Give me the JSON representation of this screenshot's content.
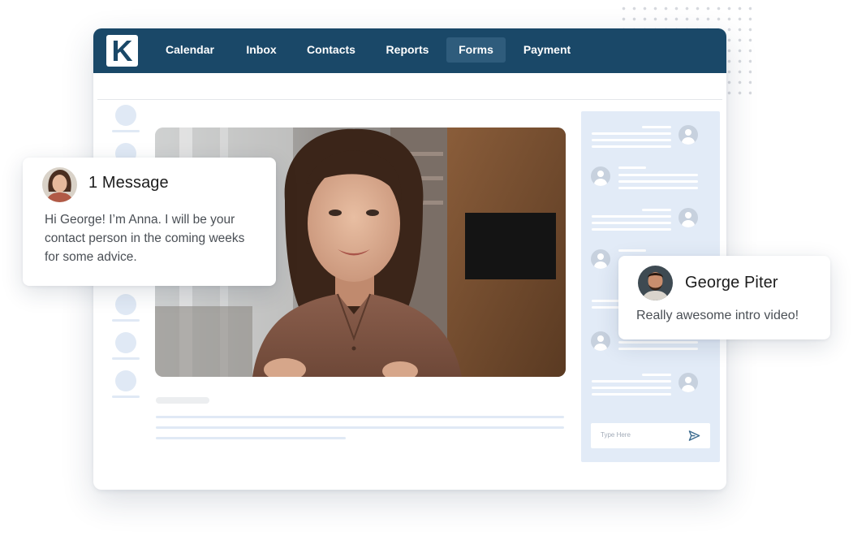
{
  "app": {
    "logo_letter": "K"
  },
  "nav": {
    "items": [
      {
        "label": "Calendar"
      },
      {
        "label": "Inbox"
      },
      {
        "label": "Contacts"
      },
      {
        "label": "Reports"
      },
      {
        "label": "Forms",
        "active": true
      },
      {
        "label": "Payment"
      }
    ]
  },
  "chat": {
    "input_placeholder": "Type Here"
  },
  "message_card": {
    "title": "1 Message",
    "text": "Hi George! I’m Anna. I will be your contact person in the coming weeks for some advice."
  },
  "comment_card": {
    "name": "George Piter",
    "text": "Really awesome intro video!"
  },
  "colors": {
    "navbar": "#1a4868",
    "active_tab": "#2f5c7c",
    "chat_panel": "#e2ebf7"
  },
  "icons": {
    "send": "send-icon",
    "avatar_placeholder": "user-placeholder-icon"
  }
}
